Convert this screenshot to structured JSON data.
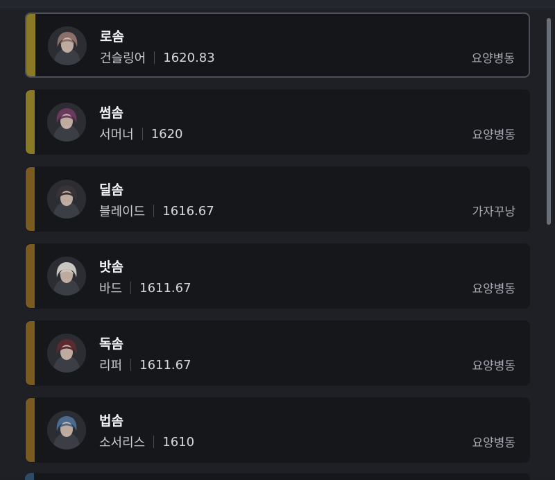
{
  "characters": [
    {
      "name": "로솜",
      "class": "건슬링어",
      "item_level": "1620.83",
      "guild": "요양병동",
      "accent": "#8a7a25",
      "selected": true,
      "avatar_hue": "#8b6f6a"
    },
    {
      "name": "썸솜",
      "class": "서머너",
      "item_level": "1620",
      "guild": "요양병동",
      "accent": "#8a7a25",
      "selected": false,
      "avatar_hue": "#6a3a5e"
    },
    {
      "name": "딜솜",
      "class": "블레이드",
      "item_level": "1616.67",
      "guild": "가자꾸낭",
      "accent": "#7a5a1e",
      "selected": false,
      "avatar_hue": "#3a3335"
    },
    {
      "name": "밧솜",
      "class": "바드",
      "item_level": "1611.67",
      "guild": "요양병동",
      "accent": "#7a5a1e",
      "selected": false,
      "avatar_hue": "#c9c6c2"
    },
    {
      "name": "독솜",
      "class": "리퍼",
      "item_level": "1611.67",
      "guild": "요양병동",
      "accent": "#7a5a1e",
      "selected": false,
      "avatar_hue": "#5a2a2e"
    },
    {
      "name": "법솜",
      "class": "소서리스",
      "item_level": "1610",
      "guild": "요양병동",
      "accent": "#7a5a1e",
      "selected": false,
      "avatar_hue": "#4a6a8e"
    }
  ]
}
